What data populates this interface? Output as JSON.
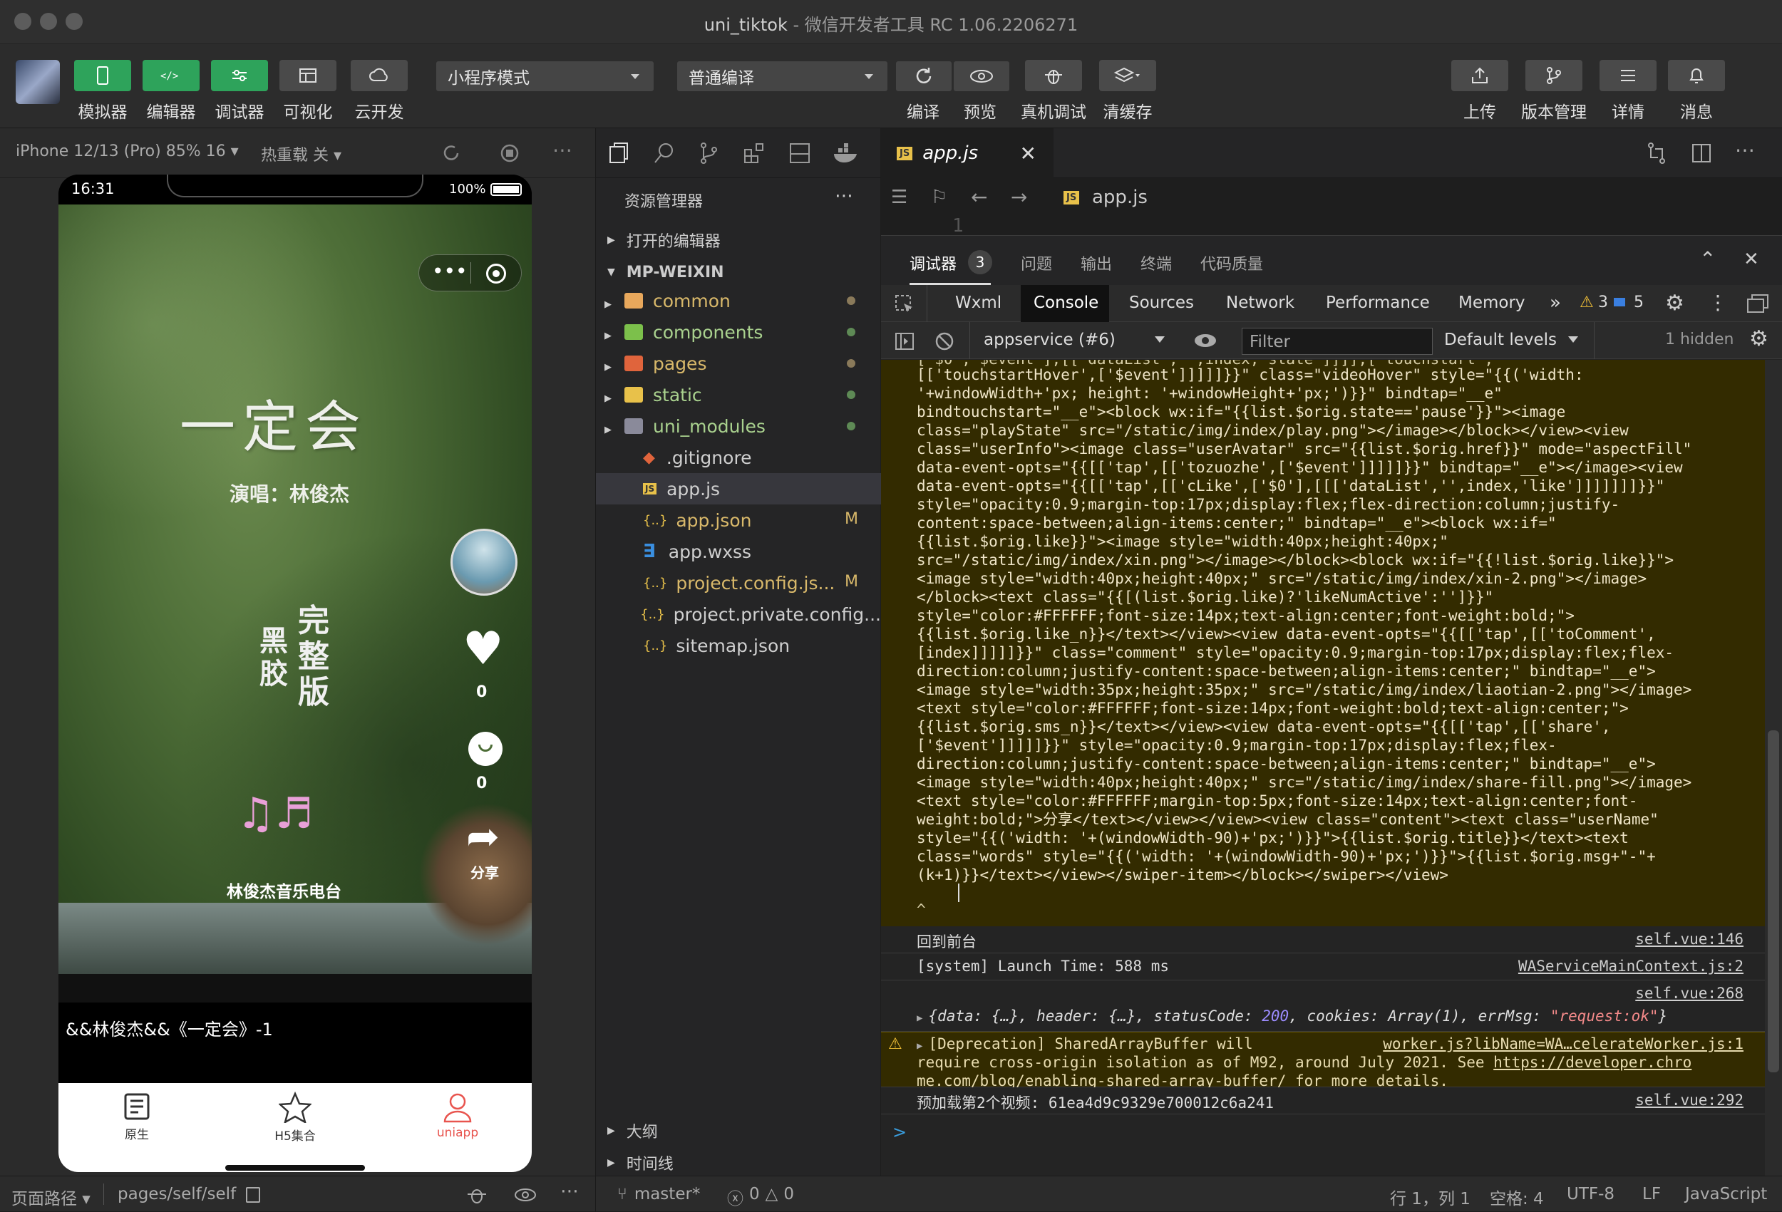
{
  "window": {
    "title_name": "uni_tiktok",
    "title_rest": " - 微信开发者工具 RC 1.06.2206271"
  },
  "toolbar": {
    "left_buttons": [
      "模拟器",
      "编辑器",
      "调试器",
      "可视化",
      "云开发"
    ],
    "mode_select": "小程序模式",
    "compile_select": "普通编译",
    "mid_buttons": [
      "编译",
      "预览",
      "真机调试",
      "清缓存"
    ],
    "right_buttons": [
      "上传",
      "版本管理",
      "详情",
      "消息"
    ]
  },
  "simulator": {
    "device": "iPhone 12/13 (Pro) 85% 16 ▾",
    "hot_reload": "热重载 关 ▾",
    "time": "16:31",
    "battery": "100%",
    "song_title": "一定会",
    "singer": "演唱：林俊杰",
    "vertical_text_1": "完整版",
    "vertical_text_2": "黑胶",
    "like_count": "0",
    "comment_count": "0",
    "share_label": "分享",
    "radio": "林俊杰音乐电台",
    "caption": "&&林俊杰&&《一定会》-1",
    "tabs": [
      {
        "label": "原生",
        "icon": "document-icon"
      },
      {
        "label": "H5集合",
        "icon": "star-icon"
      },
      {
        "label": "uniapp",
        "icon": "user-icon"
      }
    ],
    "active_tab_color": "#e8544e"
  },
  "explorer": {
    "title": "资源管理器",
    "open_editors": "打开的编辑器",
    "root": "MP-WEIXIN",
    "items": [
      {
        "name": "common",
        "type": "folder",
        "color": "#e8a85c",
        "dot": "#8a7a5a"
      },
      {
        "name": "components",
        "type": "folder",
        "color": "#7cc04b",
        "dot": "#5e8a55"
      },
      {
        "name": "pages",
        "type": "folder",
        "color": "#e0643c",
        "dot": "#8a7a5a"
      },
      {
        "name": "static",
        "type": "folder",
        "color": "#e8c14a",
        "dot": "#5e8a55"
      },
      {
        "name": "uni_modules",
        "type": "folder",
        "color": "#8a8a9a",
        "dot": "#5e8a55"
      },
      {
        "name": ".gitignore",
        "type": "git"
      },
      {
        "name": "app.js",
        "type": "js"
      },
      {
        "name": "app.json",
        "type": "json",
        "badge": "M"
      },
      {
        "name": "app.wxss",
        "type": "css"
      },
      {
        "name": "project.config.js...",
        "type": "json",
        "badge": "M"
      },
      {
        "name": "project.private.config...",
        "type": "json"
      },
      {
        "name": "sitemap.json",
        "type": "json"
      }
    ],
    "outline": "大纲",
    "timeline": "时间线"
  },
  "editor": {
    "tab": "app.js",
    "breadcrumb": "app.js",
    "line_no": "1"
  },
  "devtools": {
    "panel_tabs": [
      "调试器",
      "问题",
      "输出",
      "终端",
      "代码质量"
    ],
    "debugger_badge": "3",
    "tabs": [
      "Wxml",
      "Console",
      "Sources",
      "Network",
      "Performance",
      "Memory"
    ],
    "active_tab": "Console",
    "warn_count": "3",
    "info_count": "5",
    "context": "appservice (#6)",
    "filter_placeholder": "Filter",
    "levels": "Default levels",
    "hidden": "1 hidden"
  },
  "console": {
    "code_lines": [
      "[['touchstartHover',['$event']]]]]}}\" class=\"videoHover\" style=\"{{('width:",
      "'+windowWidth+'px; height: '+windowHeight+'px;')}}\" bindtap=\"__e\"",
      "bindtouchstart=\"__e\"><block wx:if=\"{{list.$orig.state=='pause'}}\"><image",
      "class=\"playState\" src=\"/static/img/index/play.png\"></image></block></view><view",
      "class=\"userInfo\"><image class=\"userAvatar\" src=\"{{list.$orig.href}}\" mode=\"aspectFill\"",
      "data-event-opts=\"{{[['tap',[['tozuozhe',['$event']]]]]}}\" bindtap=\"__e\"></image><view",
      "data-event-opts=\"{{[['tap',[['cLike',['$0'],[[['dataList','',index,'like']]]]]]]}}\"",
      "style=\"opacity:0.9;margin-top:17px;display:flex;flex-direction:column;justify-",
      "content:space-between;align-items:center;\" bindtap=\"__e\"><block wx:if=\"",
      "{{list.$orig.like}}\"><image style=\"width:40px;height:40px;\"",
      "src=\"/static/img/index/xin.png\"></image></block><block wx:if=\"{{!list.$orig.like}}\">",
      "<image style=\"width:40px;height:40px;\" src=\"/static/img/index/xin-2.png\"></image>",
      "</block><text class=\"{{[(list.$orig.like)?'likeNumActive':'']}}\"",
      "style=\"color:#FFFFFF;font-size:14px;text-align:center;font-weight:bold;\">",
      "{{list.$orig.like_n}}</text></view><view data-event-opts=\"{{[['tap',[['toComment',",
      "[index]]]]]}}\" class=\"comment\" style=\"opacity:0.9;margin-top:17px;display:flex;flex-",
      "direction:column;justify-content:space-between;align-items:center;\" bindtap=\"__e\">",
      "<image style=\"width:35px;height:35px;\" src=\"/static/img/index/liaotian-2.png\"></image>",
      "<text style=\"color:#FFFFFF;font-size:14px;font-weight:bold;text-align:center;\">",
      "{{list.$orig.sms_n}}</text></view><view data-event-opts=\"{{[['tap',[['share',",
      "['$event']]]]]}}\" style=\"opacity:0.9;margin-top:17px;display:flex;flex-",
      "direction:column;justify-content:space-between;align-items:center;\" bindtap=\"__e\">",
      "<image style=\"width:40px;height:40px;\" src=\"/static/img/index/share-fill.png\"></image>",
      "<text style=\"color:#FFFFFF;margin-top:5px;font-size:14px;text-align:center;font-",
      "weight:bold;\">分享</text></view></view><view class=\"content\"><text class=\"userName\"",
      "style=\"{{('width: '+(windowWidth-90)+'px;')}}\">{{list.$orig.title}}</text><text",
      "class=\"words\" style=\"{{('width: '+(windowWidth-90)+'px;')}}\">{{list.$orig.msg+\"-\"+",
      "(k+1)}}</text></view></swiper-item></block></swiper></view>"
    ],
    "caret": "^",
    "logs": [
      {
        "text": "回到前台",
        "src": "self.vue:146"
      },
      {
        "text": "[system] Launch Time: 588 ms",
        "src": "WAServiceMainContext.js:2"
      },
      {
        "src": "self.vue:268",
        "obj_a": "{data: {…}, header: {…}, statusCode: ",
        "obj_num": "200",
        "obj_b": ", cookies: Array(1), errMsg: ",
        "obj_str": "\"request:ok\"",
        "obj_c": "}"
      },
      {
        "warn1": "[Deprecation] SharedArrayBuffer will",
        "src": "worker.js?libName=WA…celerateWorker.js:1",
        "warn2": "require cross-origin isolation as of M92, around July 2021. See ",
        "link1": "https://developer.chro",
        "link2": "me.com/blog/enabling-shared-array-buffer/",
        "warn3": " for more details."
      },
      {
        "text": "预加载第2个视频: 61ea4d9c9329e700012c6a241",
        "src": "self.vue:292"
      }
    ],
    "prompt": ">"
  },
  "statusbar": {
    "page_path_label": "页面路径 ▾",
    "page_path": "pages/self/self",
    "branch": "master*",
    "errors": "0",
    "warnings": "0",
    "position": "行 1，列 1",
    "spaces": "空格: 4",
    "encoding": "UTF-8",
    "eol": "LF",
    "language": "JavaScript"
  },
  "colors": {
    "accent_green": "#2ea35b",
    "console_warn_bg": "#332b00",
    "link": "#cfcfcf"
  }
}
